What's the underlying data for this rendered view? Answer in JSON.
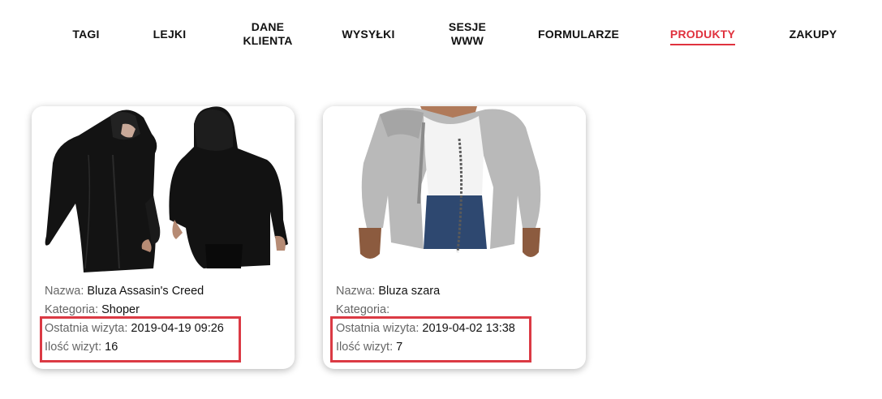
{
  "nav": {
    "items": [
      {
        "label": "TAGI",
        "active": false
      },
      {
        "label": "LEJKI",
        "active": false
      },
      {
        "label": "DANE\nKLIENTA",
        "active": false
      },
      {
        "label": "WYSYŁKI",
        "active": false
      },
      {
        "label": "SESJE\nWWW",
        "active": false
      },
      {
        "label": "FORMULARZE",
        "active": false
      },
      {
        "label": "PRODUKTY",
        "active": true
      },
      {
        "label": "ZAKUPY",
        "active": false
      }
    ]
  },
  "colors": {
    "accent": "#e0323e",
    "highlight_box": "#db3a44",
    "label_gray": "#666666"
  },
  "labels": {
    "name": "Nazwa:",
    "category": "Kategoria:",
    "last_visit": "Ostatnia wizyta:",
    "visit_count": "Ilość wizyt:"
  },
  "products": [
    {
      "image_icon": "black-hoodie-photo",
      "name": "Bluza Assasin's Creed",
      "category": "Shoper",
      "last_visit": "2019-04-19 09:26",
      "visit_count": "16"
    },
    {
      "image_icon": "grey-hoodie-photo",
      "name": "Bluza szara",
      "category": "",
      "last_visit": "2019-04-02 13:38",
      "visit_count": "7"
    }
  ]
}
